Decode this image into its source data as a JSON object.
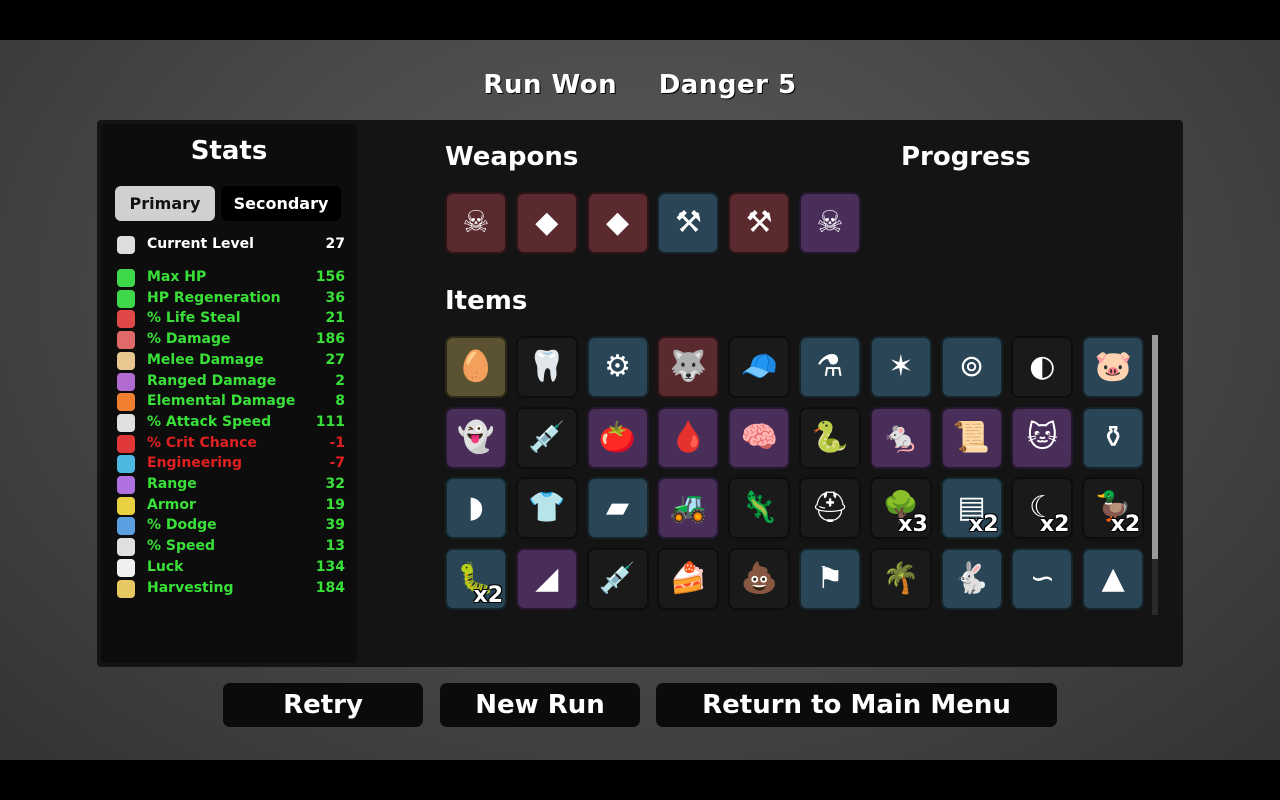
{
  "header": {
    "result": "Run Won",
    "danger": "Danger 5"
  },
  "stats": {
    "title": "Stats",
    "tabs": {
      "primary": "Primary",
      "secondary": "Secondary"
    },
    "rows": [
      {
        "label": "Current Level",
        "value": "27",
        "color": "#ffffff",
        "icon": "level-icon",
        "icon_color": "#dddddd"
      },
      {
        "label": "Max HP",
        "value": "156",
        "color": "#38e038",
        "icon": "heart-icon",
        "icon_color": "#3fd84a"
      },
      {
        "label": "HP Regeneration",
        "value": "36",
        "color": "#38e038",
        "icon": "heart-plus-icon",
        "icon_color": "#3fd84a"
      },
      {
        "label": "% Life Steal",
        "value": "21",
        "color": "#38e038",
        "icon": "fangs-icon",
        "icon_color": "#e04848"
      },
      {
        "label": "% Damage",
        "value": "186",
        "color": "#38e038",
        "icon": "muscle-icon",
        "icon_color": "#e06a6a"
      },
      {
        "label": "Melee Damage",
        "value": "27",
        "color": "#38e038",
        "icon": "sword-icon",
        "icon_color": "#e8c890"
      },
      {
        "label": "Ranged Damage",
        "value": "2",
        "color": "#38e038",
        "icon": "bow-icon",
        "icon_color": "#b06ad0"
      },
      {
        "label": "Elemental Damage",
        "value": "8",
        "color": "#38e038",
        "icon": "flame-icon",
        "icon_color": "#f08030"
      },
      {
        "label": "% Attack Speed",
        "value": "111",
        "color": "#38e038",
        "icon": "hourglass-icon",
        "icon_color": "#e0e0e0"
      },
      {
        "label": "% Crit Chance",
        "value": "-1",
        "color": "#e02020",
        "icon": "crit-icon",
        "icon_color": "#e03838"
      },
      {
        "label": "Engineering",
        "value": "-7",
        "color": "#e02020",
        "icon": "wrench-icon",
        "icon_color": "#4ab8e0"
      },
      {
        "label": "Range",
        "value": "32",
        "color": "#38e038",
        "icon": "range-icon",
        "icon_color": "#b070e0"
      },
      {
        "label": "Armor",
        "value": "19",
        "color": "#38e038",
        "icon": "shield-icon",
        "icon_color": "#e8d040"
      },
      {
        "label": "% Dodge",
        "value": "39",
        "color": "#38e038",
        "icon": "dodge-icon",
        "icon_color": "#5aa0e0"
      },
      {
        "label": "% Speed",
        "value": "13",
        "color": "#38e038",
        "icon": "boot-icon",
        "icon_color": "#e0e0e0"
      },
      {
        "label": "Luck",
        "value": "134",
        "color": "#38e038",
        "icon": "dice-icon",
        "icon_color": "#f0f0f0"
      },
      {
        "label": "Harvesting",
        "value": "184",
        "color": "#38e038",
        "icon": "wheat-icon",
        "icon_color": "#e8c860"
      }
    ]
  },
  "weapons": {
    "title": "Weapons",
    "slots": [
      {
        "icon": "skull-axe-icon",
        "glyph": "☠",
        "bg": "#5a2a2e"
      },
      {
        "icon": "crystal-blade-icon",
        "glyph": "◆",
        "bg": "#5a2a2e"
      },
      {
        "icon": "crystal-blade-icon",
        "glyph": "◆",
        "bg": "#5a2a2e"
      },
      {
        "icon": "axe-icon",
        "glyph": "⚒",
        "bg": "#2a4656"
      },
      {
        "icon": "axe-icon",
        "glyph": "⚒",
        "bg": "#5a2a2e"
      },
      {
        "icon": "skull-axe-icon",
        "glyph": "☠",
        "bg": "#4a2e5a"
      }
    ]
  },
  "progress": {
    "title": "Progress"
  },
  "items": {
    "title": "Items",
    "rows": [
      [
        {
          "icon": "egg-icon",
          "glyph": "🥚",
          "bg": "#5a5230"
        },
        {
          "icon": "tooth-icon",
          "glyph": "🦷",
          "bg": "#1a1a1a"
        },
        {
          "icon": "gadget-icon",
          "glyph": "⚙",
          "bg": "#2a4656"
        },
        {
          "icon": "wolf-icon",
          "glyph": "🐺",
          "bg": "#5a2a2e"
        },
        {
          "icon": "propeller-hat-icon",
          "glyph": "🧢",
          "bg": "#1a1a1a"
        },
        {
          "icon": "potion-icon",
          "glyph": "⚗",
          "bg": "#2a4656"
        },
        {
          "icon": "claw-icon",
          "glyph": "✶",
          "bg": "#2a4656"
        },
        {
          "icon": "trap-icon",
          "glyph": "⊚",
          "bg": "#2a4656"
        },
        {
          "icon": "mouth-icon",
          "glyph": "◐",
          "bg": "#1a1a1a"
        },
        {
          "icon": "piggy-bank-icon",
          "glyph": "🐷",
          "bg": "#2a4656"
        }
      ],
      [
        {
          "icon": "ghost-icon",
          "glyph": "👻",
          "bg": "#4a2e5a"
        },
        {
          "icon": "syringe-icon",
          "glyph": "💉",
          "bg": "#1a1a1a"
        },
        {
          "icon": "tomato-icon",
          "glyph": "🍅",
          "bg": "#4a2e5a"
        },
        {
          "icon": "blood-bag-icon",
          "glyph": "🩸",
          "bg": "#4a2e5a"
        },
        {
          "icon": "brain-icon",
          "glyph": "🧠",
          "bg": "#4a2e5a"
        },
        {
          "icon": "snake-icon",
          "glyph": "🐍",
          "bg": "#1a1a1a"
        },
        {
          "icon": "mouse-icon",
          "glyph": "🐁",
          "bg": "#4a2e5a"
        },
        {
          "icon": "scroll-icon",
          "glyph": "📜",
          "bg": "#4a2e5a"
        },
        {
          "icon": "lucky-cat-icon",
          "glyph": "🐱",
          "bg": "#4a2e5a"
        },
        {
          "icon": "flask-icon",
          "glyph": "⚱",
          "bg": "#2a4656"
        }
      ],
      [
        {
          "icon": "armor-plate-icon",
          "glyph": "◗",
          "bg": "#2a4656",
          "count": ""
        },
        {
          "icon": "shirt-icon",
          "glyph": "👕",
          "bg": "#1a1a1a",
          "count": ""
        },
        {
          "icon": "sleeping-bag-icon",
          "glyph": "▰",
          "bg": "#2a4656",
          "count": ""
        },
        {
          "icon": "tractor-icon",
          "glyph": "🚜",
          "bg": "#4a2e5a",
          "count": ""
        },
        {
          "icon": "lizard-icon",
          "glyph": "🦎",
          "bg": "#1a1a1a",
          "count": ""
        },
        {
          "icon": "helmet-icon",
          "glyph": "⛑",
          "bg": "#1a1a1a",
          "count": ""
        },
        {
          "icon": "tree-icon",
          "glyph": "🌳",
          "bg": "#1a1a1a",
          "count": "x3"
        },
        {
          "icon": "cape-icon",
          "glyph": "▤",
          "bg": "#2a4656",
          "count": "x2"
        },
        {
          "icon": "scythe-icon",
          "glyph": "☾",
          "bg": "#1a1a1a",
          "count": "x2"
        },
        {
          "icon": "duck-icon",
          "glyph": "🦆",
          "bg": "#1a1a1a",
          "count": "x2"
        }
      ],
      [
        {
          "icon": "larva-icon",
          "glyph": "🐛",
          "bg": "#2a4656",
          "count": "x2"
        },
        {
          "icon": "fin-icon",
          "glyph": "◢",
          "bg": "#4a2e5a",
          "count": ""
        },
        {
          "icon": "injection-icon",
          "glyph": "💉",
          "bg": "#1a1a1a",
          "count": ""
        },
        {
          "icon": "cake-icon",
          "glyph": "🍰",
          "bg": "#1a1a1a",
          "count": ""
        },
        {
          "icon": "poop-icon",
          "glyph": "💩",
          "bg": "#1a1a1a",
          "count": ""
        },
        {
          "icon": "banner-icon",
          "glyph": "⚑",
          "bg": "#2a4656",
          "count": ""
        },
        {
          "icon": "palm-tree-icon",
          "glyph": "🌴",
          "bg": "#1a1a1a",
          "count": ""
        },
        {
          "icon": "rabbit-icon",
          "glyph": "🐇",
          "bg": "#2a4656",
          "count": ""
        },
        {
          "icon": "worm-icon",
          "glyph": "∽",
          "bg": "#2a4656",
          "count": ""
        },
        {
          "icon": "bullet-icon",
          "glyph": "▲",
          "bg": "#2a4656",
          "count": ""
        }
      ]
    ]
  },
  "buttons": {
    "retry": "Retry",
    "new_run": "New Run",
    "main_menu": "Return to Main Menu"
  }
}
